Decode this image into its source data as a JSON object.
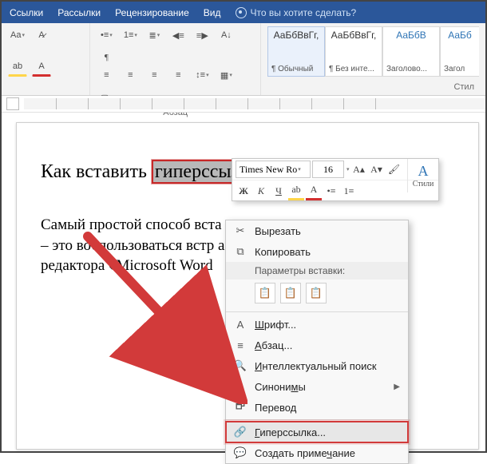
{
  "tabs": {
    "links": "Ссылки",
    "mailings": "Рассылки",
    "review": "Рецензирование",
    "view": "Вид",
    "tellme": "Что вы хотите сделать?"
  },
  "ribbon": {
    "paragraph_label": "Абзац",
    "styles_label": "Стил",
    "styles": [
      {
        "sample": "АаБбВвГг,",
        "name": "¶ Обычный"
      },
      {
        "sample": "АаБбВвГг,",
        "name": "¶ Без инте..."
      },
      {
        "sample": "АаБбВ",
        "name": "Заголово..."
      },
      {
        "sample": "АаБб",
        "name": "Загол"
      }
    ]
  },
  "document": {
    "heading_pre": "Как вставить ",
    "heading_sel": "гиперссылку",
    "body": "Самый простой способ вста                                  умент гипе\n– это воспользоваться встр                                    ами текстово\nредактора «Microsoft Word"
  },
  "mini": {
    "font": "Times New Ro",
    "size": "16",
    "styles_label": "Стили"
  },
  "context": {
    "cut": "Вырезать",
    "copy": "Копировать",
    "paste_header": "Параметры вставки:",
    "font": "Шрифт...",
    "paragraph": "Абзац...",
    "smart": "Интеллектуальный поиск",
    "synonyms": "Синонимы",
    "translate": "Перевод",
    "hyperlink": "Гиперссылка...",
    "comment": "Создать примечание"
  }
}
